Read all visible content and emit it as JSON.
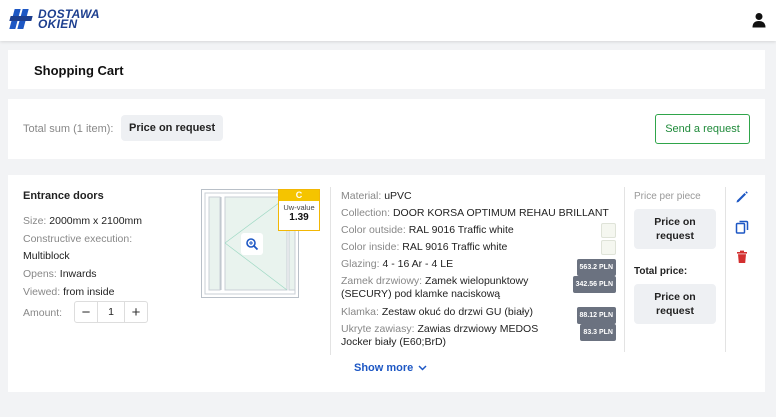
{
  "brand": {
    "line1": "DOSTAWA",
    "line2": "OKIEN"
  },
  "page": {
    "title": "Shopping Cart"
  },
  "summary": {
    "label": "Total sum (1 item):",
    "price": "Price on request",
    "send_label": "Send a request"
  },
  "item": {
    "name": "Entrance doors",
    "size_label": "Size:",
    "size": "2000mm x 2100mm",
    "construction_label": "Constructive execution:",
    "construction": "Multiblock",
    "opens_label": "Opens:",
    "opens": "Inwards",
    "viewed_label": "Viewed:",
    "viewed": "from inside",
    "amount_label": "Amount:",
    "amount": "1",
    "energy": {
      "class": "C",
      "label": "Uw-value",
      "value": "1.39"
    },
    "specs": [
      {
        "label": "Material:",
        "value": "uPVC"
      },
      {
        "label": "Collection:",
        "value": "DOOR KORSA OPTIMUM REHAU BRILLANT"
      },
      {
        "label": "Color outside:",
        "value": "RAL 9016 Traffic white"
      },
      {
        "label": "Color inside:",
        "value": "RAL 9016 Traffic white"
      },
      {
        "label": "Glazing:",
        "value": "4 - 16 Ar - 4 LE",
        "price": "563.2 PLN"
      },
      {
        "label": "Zamek drzwiowy:",
        "value": "Zamek wielopunktowy (SECURY) pod klamke naciskową",
        "price": "342.56 PLN"
      },
      {
        "label": "Klamka:",
        "value": "Zestaw okuć do drzwi GU (biały)",
        "price": "88.12 PLN"
      },
      {
        "label": "Ukryte zawiasy:",
        "value": "Zawias drzwiowy MEDOS Jocker biały (E60;BrD)",
        "price": "83.3 PLN"
      }
    ],
    "price_per_piece_label": "Price per piece",
    "price_per_piece": "Price on request",
    "total_price_label": "Total price:",
    "total_price": "Price on request",
    "show_more": "Show more"
  },
  "colors": {
    "accent": "#1d57c4",
    "success": "#2fa54a",
    "danger": "#d32f2f",
    "energy": "#f5c400"
  }
}
